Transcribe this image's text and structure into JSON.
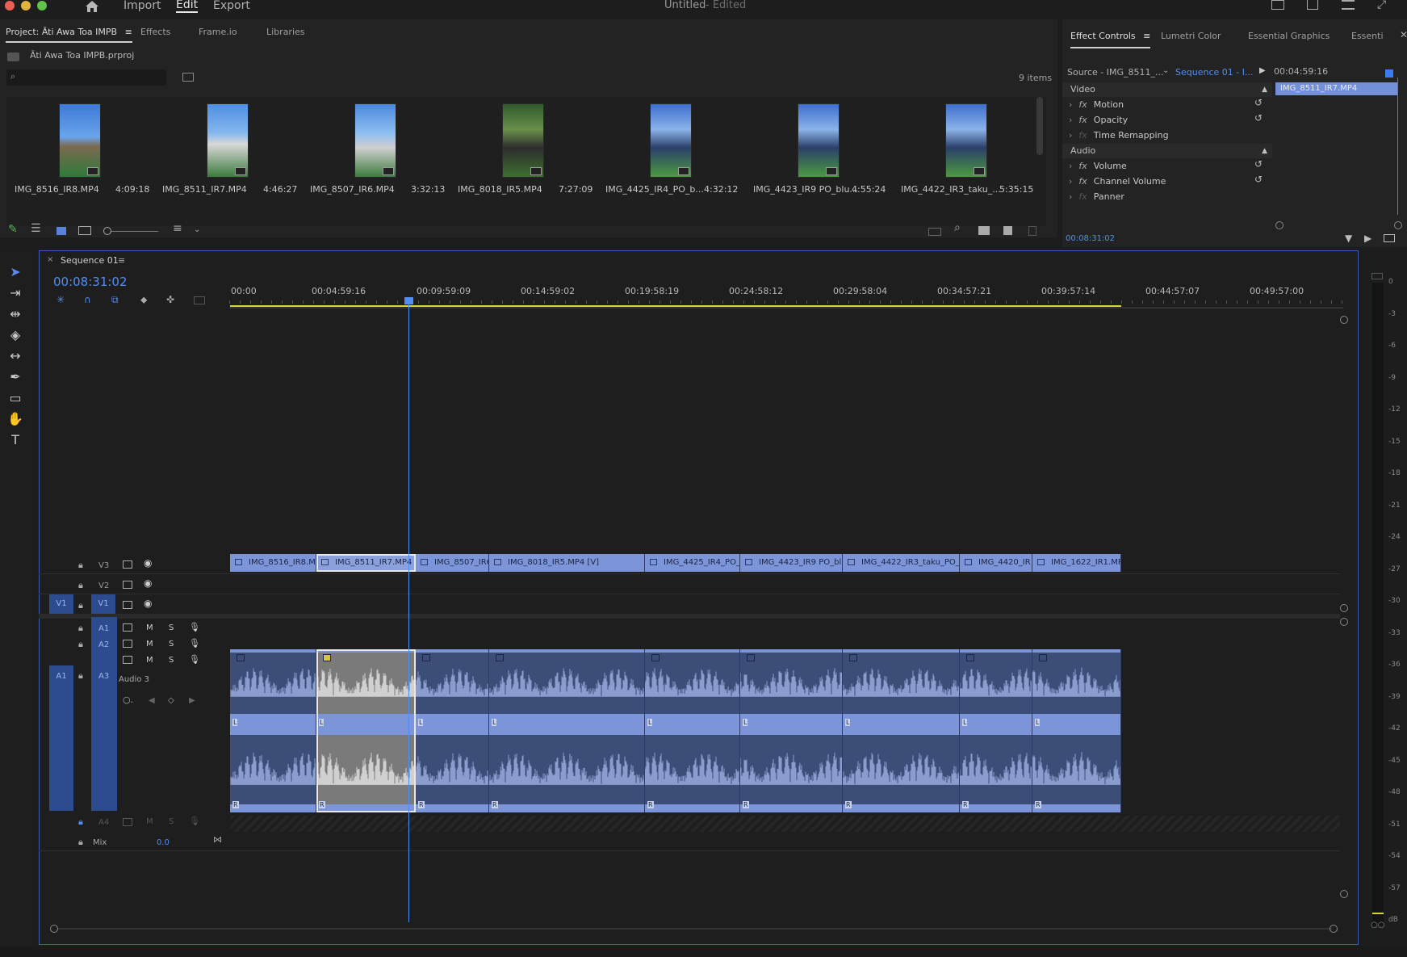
{
  "window": {
    "title": "Untitled",
    "status": "- Edited"
  },
  "topnav": {
    "import": "Import",
    "edit": "Edit",
    "export": "Export"
  },
  "project": {
    "tabs": [
      "Project: Āti Awa Toa IMPB",
      "Effects",
      "Frame.io",
      "Libraries"
    ],
    "file": "Āti Awa Toa IMPB.prproj",
    "items_count": "9 items",
    "clips": [
      {
        "name": "IMG_8516_IR8.MP4",
        "duration": "4:09:18"
      },
      {
        "name": "IMG_8511_IR7.MP4",
        "duration": "4:46:27"
      },
      {
        "name": "IMG_8507_IR6.MP4",
        "duration": "3:32:13"
      },
      {
        "name": "IMG_8018_IR5.MP4",
        "duration": "7:27:09"
      },
      {
        "name": "IMG_4425_IR4_PO_b...",
        "duration": "4:32:12"
      },
      {
        "name": "IMG_4423_IR9 PO_blu...",
        "duration": "4:55:24"
      },
      {
        "name": "IMG_4422_IR3_taku_...",
        "duration": "5:35:15"
      }
    ]
  },
  "effect_controls": {
    "tabs": [
      "Effect Controls",
      "Lumetri Color",
      "Essential Graphics",
      "Essenti"
    ],
    "source": "Source - IMG_8511_...",
    "sequence": "Sequence 01 - I...",
    "timecode_top": "00:04:59:16",
    "clip_label": "IMG_8511_IR7.MP4",
    "video_section": "Video",
    "video_effects": [
      "Motion",
      "Opacity",
      "Time Remapping"
    ],
    "audio_section": "Audio",
    "audio_effects": [
      "Volume",
      "Channel Volume",
      "Panner"
    ],
    "timecode_bottom": "00:08:31:02"
  },
  "timeline": {
    "sequence_tab": "Sequence 01",
    "playhead_time": "00:08:31:02",
    "ruler": [
      "00:00",
      "00:04:59:16",
      "00:09:59:09",
      "00:14:59:02",
      "00:19:58:19",
      "00:24:58:12",
      "00:29:58:04",
      "00:34:57:21",
      "00:39:57:14",
      "00:44:57:07",
      "00:49:57:00"
    ],
    "video_tracks": [
      "V3",
      "V2",
      "V1"
    ],
    "source_v": "V1",
    "audio_tracks": [
      "A1",
      "A2",
      "A3"
    ],
    "source_a": "A1",
    "audio3_name": "Audio 3",
    "a4": "A4",
    "mix_label": "Mix",
    "mix_value": "0.0",
    "track_buttons": {
      "m": "M",
      "s": "S"
    },
    "video_clips": [
      "IMG_8516_IR8.MP4",
      "IMG_8511_IR7.MP4",
      "IMG_8507_IR6",
      "IMG_8018_IR5.MP4 [V]",
      "IMG_4425_IR4_PO_",
      "IMG_4423_IR9 PO_blu",
      "IMG_4422_IR3_taku_PO_b",
      "IMG_4420_IR",
      "IMG_1622_IR1.MP"
    ],
    "channel_left": "L",
    "channel_right": "R"
  },
  "meter": {
    "labels": [
      "0",
      "-3",
      "-6",
      "-9",
      "-12",
      "-15",
      "-18",
      "-21",
      "-24",
      "-27",
      "-30",
      "-33",
      "-36",
      "-39",
      "-42",
      "-45",
      "-48",
      "-51",
      "-54",
      "-57",
      "dB"
    ]
  },
  "colors": {
    "accent": "#3d7bf5",
    "clip": "#7b95d8",
    "panel": "#232323",
    "timeline_bar": "#d7d53c"
  }
}
